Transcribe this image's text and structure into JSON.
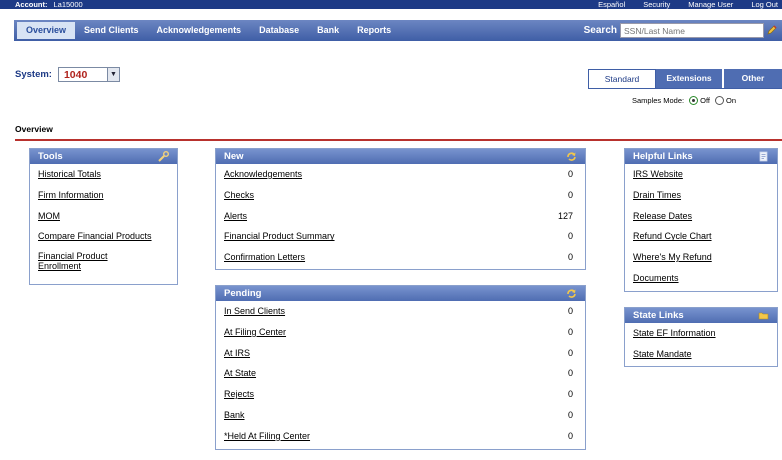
{
  "topbar": {
    "account_label": "Account:",
    "account_value": "La15000",
    "links": [
      "Español",
      "Security",
      "Manage User",
      "Log Out"
    ]
  },
  "nav": {
    "tabs": [
      "Overview",
      "Send Clients",
      "Acknowledgements",
      "Database",
      "Bank",
      "Reports"
    ],
    "active_tab": "Overview",
    "search_label": "Search",
    "search_placeholder": "SSN/Last Name"
  },
  "system": {
    "label": "System:",
    "value": "1040"
  },
  "view_tabs": [
    "Standard",
    "Extensions",
    "Other"
  ],
  "samples": {
    "label": "Samples Mode:",
    "off": "Off",
    "on": "On",
    "selected": "Off"
  },
  "page_title": "Overview",
  "tools": {
    "title": "Tools",
    "items": [
      "Historical Totals",
      "Firm Information",
      "MOM",
      "Compare Financial Products",
      "Financial Product Enrollment"
    ]
  },
  "new": {
    "title": "New",
    "rows": [
      {
        "label": "Acknowledgements",
        "count": "0"
      },
      {
        "label": "Checks",
        "count": "0"
      },
      {
        "label": "Alerts",
        "count": "127"
      },
      {
        "label": "Financial Product Summary",
        "count": "0"
      },
      {
        "label": "Confirmation Letters",
        "count": "0"
      }
    ]
  },
  "pending": {
    "title": "Pending",
    "rows": [
      {
        "label": "In Send Clients",
        "count": "0"
      },
      {
        "label": "At Filing Center",
        "count": "0"
      },
      {
        "label": "At IRS",
        "count": "0"
      },
      {
        "label": "At State",
        "count": "0"
      },
      {
        "label": "Rejects",
        "count": "0"
      },
      {
        "label": "Bank",
        "count": "0"
      },
      {
        "label": "*Held At Filing Center",
        "count": "0"
      }
    ]
  },
  "helpful": {
    "title": "Helpful Links",
    "items": [
      "IRS Website",
      "Drain Times",
      "Release Dates",
      "Refund Cycle Chart",
      "Where's My Refund",
      "Documents"
    ]
  },
  "state": {
    "title": "State Links",
    "items": [
      "State EF Information",
      "State Mandate"
    ]
  },
  "colors": {
    "brand_dark": "#1d3a86",
    "header_blue": "#4f6db2",
    "accent_red": "#b8312d",
    "system_value": "#b0221c"
  }
}
